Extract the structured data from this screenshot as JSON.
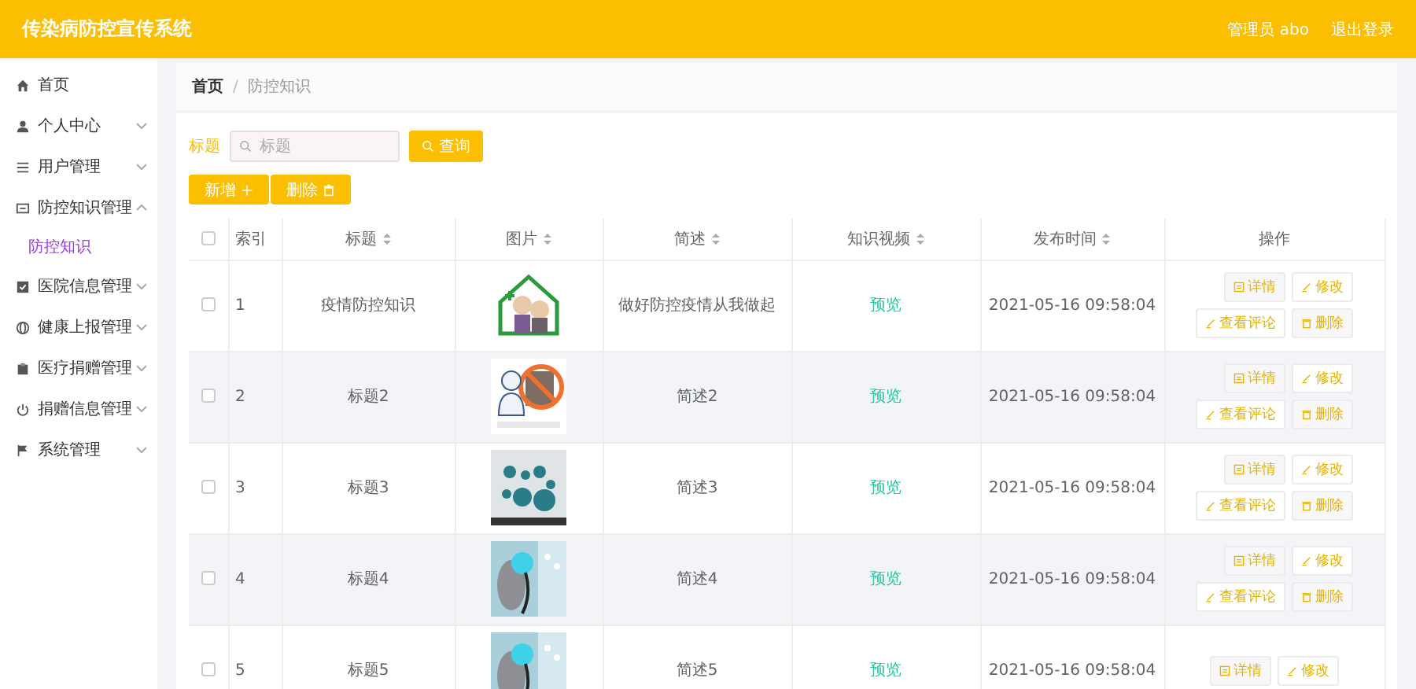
{
  "header": {
    "title": "传染病防控宣传系统",
    "user": "管理员 abo",
    "logout": "退出登录"
  },
  "sidebar": {
    "items": [
      {
        "label": "首页"
      },
      {
        "label": "个人中心",
        "expanded": false
      },
      {
        "label": "用户管理",
        "expanded": false
      },
      {
        "label": "防控知识管理",
        "expanded": true,
        "children": [
          {
            "label": "防控知识",
            "selected": true
          }
        ]
      },
      {
        "label": "医院信息管理",
        "expanded": false
      },
      {
        "label": "健康上报管理",
        "expanded": false
      },
      {
        "label": "医疗捐赠管理",
        "expanded": false
      },
      {
        "label": "捐赠信息管理",
        "expanded": false
      },
      {
        "label": "系统管理",
        "expanded": false
      }
    ]
  },
  "breadcrumb": {
    "items": [
      "首页",
      "防控知识"
    ],
    "separator": "/"
  },
  "search": {
    "label": "标题",
    "placeholder": "标题",
    "button": "查询"
  },
  "actions": [
    "新增",
    "删除"
  ],
  "table": {
    "select_all": {
      "checked": false
    },
    "columns": [
      {
        "label": "索引",
        "sortable": false
      },
      {
        "label": "标题",
        "sortable": true
      },
      {
        "label": "图片",
        "sortable": true
      },
      {
        "label": "简述",
        "sortable": true
      },
      {
        "label": "知识视频",
        "sortable": true
      },
      {
        "label": "发布时间",
        "sortable": true
      },
      {
        "label": "操作",
        "sortable": false
      }
    ],
    "rows": [
      {
        "checked": false,
        "index": "1",
        "title": "疫情防控知识",
        "picture": {
          "kind": "picture"
        },
        "description": "做好防控疫情从我做起",
        "video": "预览",
        "time": "2021-05-16 09:58:04",
        "buttons": [
          "详情",
          "修改",
          "查看评论",
          "删除"
        ]
      },
      {
        "checked": false,
        "index": "2",
        "title": "标题2",
        "picture": {
          "kind": "picture"
        },
        "description": "简述2",
        "video": "预览",
        "time": "2021-05-16 09:58:04",
        "buttons": [
          "详情",
          "修改",
          "查看评论",
          "删除"
        ]
      },
      {
        "checked": false,
        "index": "3",
        "title": "标题3",
        "picture": {
          "kind": "picture"
        },
        "description": "简述3",
        "video": "预览",
        "time": "2021-05-16 09:58:04",
        "buttons": [
          "详情",
          "修改",
          "查看评论",
          "删除"
        ]
      },
      {
        "checked": false,
        "index": "4",
        "title": "标题4",
        "picture": {
          "kind": "picture"
        },
        "description": "简述4",
        "video": "预览",
        "time": "2021-05-16 09:58:04",
        "buttons": [
          "详情",
          "修改",
          "查看评论",
          "删除"
        ]
      },
      {
        "checked": false,
        "index": "5",
        "title": "标题5",
        "picture": {
          "kind": "picture"
        },
        "description": "简述5",
        "video": "预览",
        "time": "2021-05-16 09:58:04",
        "buttons": [
          "详情",
          "修改"
        ]
      }
    ]
  }
}
